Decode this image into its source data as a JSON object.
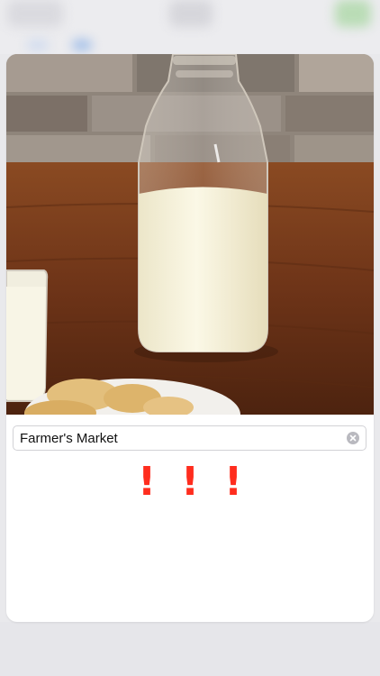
{
  "item": {
    "name_value": "Farmer's Market",
    "name_placeholder": ""
  },
  "priority": {
    "marks": [
      "!",
      "!",
      "!"
    ],
    "level": 3,
    "color": "#ff2d1e"
  },
  "icons": {
    "clear": "clear-circle-icon"
  }
}
